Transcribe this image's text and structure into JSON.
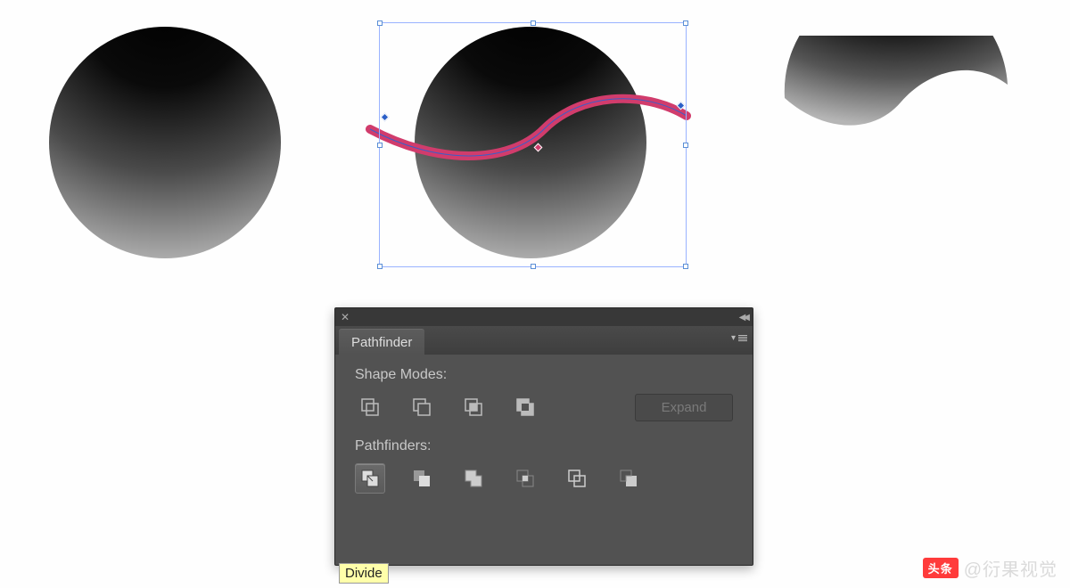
{
  "panel": {
    "title": "Pathfinder",
    "shape_modes_label": "Shape Modes:",
    "pathfinders_label": "Pathfinders:",
    "expand_label": "Expand",
    "shape_modes": [
      {
        "name": "unite"
      },
      {
        "name": "minus-front"
      },
      {
        "name": "intersect"
      },
      {
        "name": "exclude"
      }
    ],
    "pathfinders": [
      {
        "name": "divide",
        "active": true
      },
      {
        "name": "trim"
      },
      {
        "name": "merge"
      },
      {
        "name": "crop"
      },
      {
        "name": "outline"
      },
      {
        "name": "minus-back"
      }
    ]
  },
  "tooltip": "Divide",
  "watermark": {
    "prefix": "头条",
    "text": "@衍果视觉"
  },
  "artwork": {
    "steps": [
      "gradient-circle",
      "circle-with-curve-selected",
      "top-half-result"
    ],
    "curve_color": "#d13c6c"
  }
}
